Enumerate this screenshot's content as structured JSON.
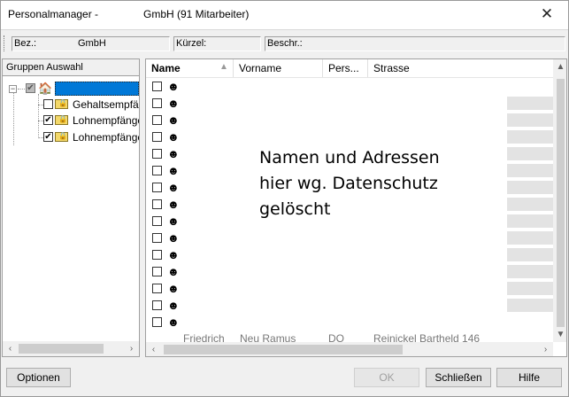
{
  "window": {
    "title": "Personalmanager -",
    "company": "GmbH (91 Mitarbeiter)",
    "close_glyph": "✕"
  },
  "filter_bar": {
    "bez_label": "Bez.:",
    "bez_value": "GmbH",
    "kuerzel_label": "Kürzel:",
    "beschr_label": "Beschr.:"
  },
  "left_panel": {
    "header": "Gruppen Auswahl",
    "tree": {
      "root_expander": "−",
      "items": [
        {
          "label": "Gehaltsempfänger",
          "checked": false
        },
        {
          "label": "Lohnempfänger",
          "checked": true
        },
        {
          "label": "Lohnempfänger",
          "checked": true
        }
      ]
    }
  },
  "list": {
    "columns": [
      {
        "label": "Name",
        "sorted": true
      },
      {
        "label": "Vorname"
      },
      {
        "label": "Pers..."
      },
      {
        "label": "Strasse"
      }
    ],
    "sort_glyph": "▲",
    "check_glyph": "✔",
    "row_count_visible": 15,
    "notice": "Namen und Adressen\nhier wg. Datenschutz\ngelöscht",
    "partial_bottom_row": [
      "Friedrich",
      "Neu Ramus",
      "DO",
      "Reinickel Bartheld 146"
    ]
  },
  "scroll": {
    "up": "▲",
    "down": "▼",
    "left": "‹",
    "right": "›"
  },
  "buttons": {
    "options": "Optionen",
    "ok": "OK",
    "close": "Schließen",
    "help": "Hilfe"
  },
  "colors": {
    "selection": "#0078d7",
    "window_bg": "#f0f0f0",
    "folder": "#f3d86a"
  },
  "icons": {
    "home": "🏠",
    "person": "☻"
  }
}
